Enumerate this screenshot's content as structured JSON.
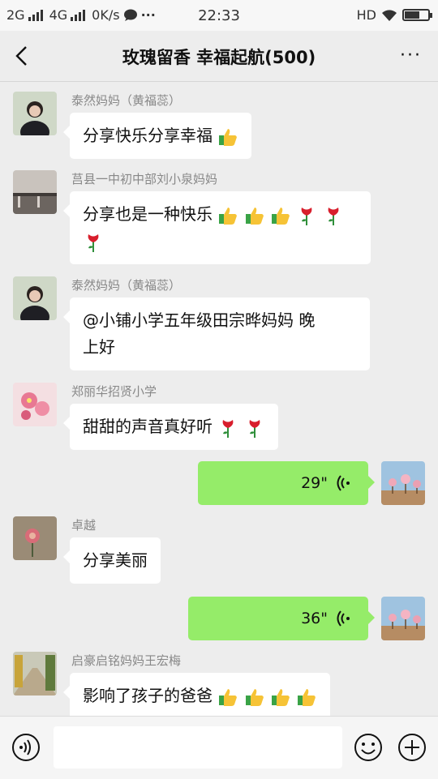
{
  "status_bar": {
    "net1": "2G",
    "net2": "4G",
    "speed": "0K/s",
    "dots": "···",
    "time": "22:33",
    "hd": "HD"
  },
  "header": {
    "title": "玫瑰留香  幸福起航(500)",
    "more": "···"
  },
  "messages": [
    {
      "sender": "泰然妈妈（黄福蕊）",
      "text": "分享快乐分享幸福"
    },
    {
      "sender": "莒县一中初中部刘小泉妈妈",
      "text": "分享也是一种快乐"
    },
    {
      "sender": "泰然妈妈（黄福蕊）",
      "text_line1": "@小铺小学五年级田宗晔妈妈  晚",
      "text_line2": "上好"
    },
    {
      "sender": "郑丽华招贤小学",
      "text": "甜甜的声音真好听"
    },
    {
      "voice_duration": "29\""
    },
    {
      "sender": "卓越",
      "text": "分享美丽"
    },
    {
      "voice_duration": "36\""
    },
    {
      "sender": "启豪启铭妈妈王宏梅",
      "text": "影响了孩子的爸爸"
    }
  ],
  "colors": {
    "self_bubble": "#95ec69",
    "other_bubble": "#ffffff",
    "background": "#ededed"
  }
}
